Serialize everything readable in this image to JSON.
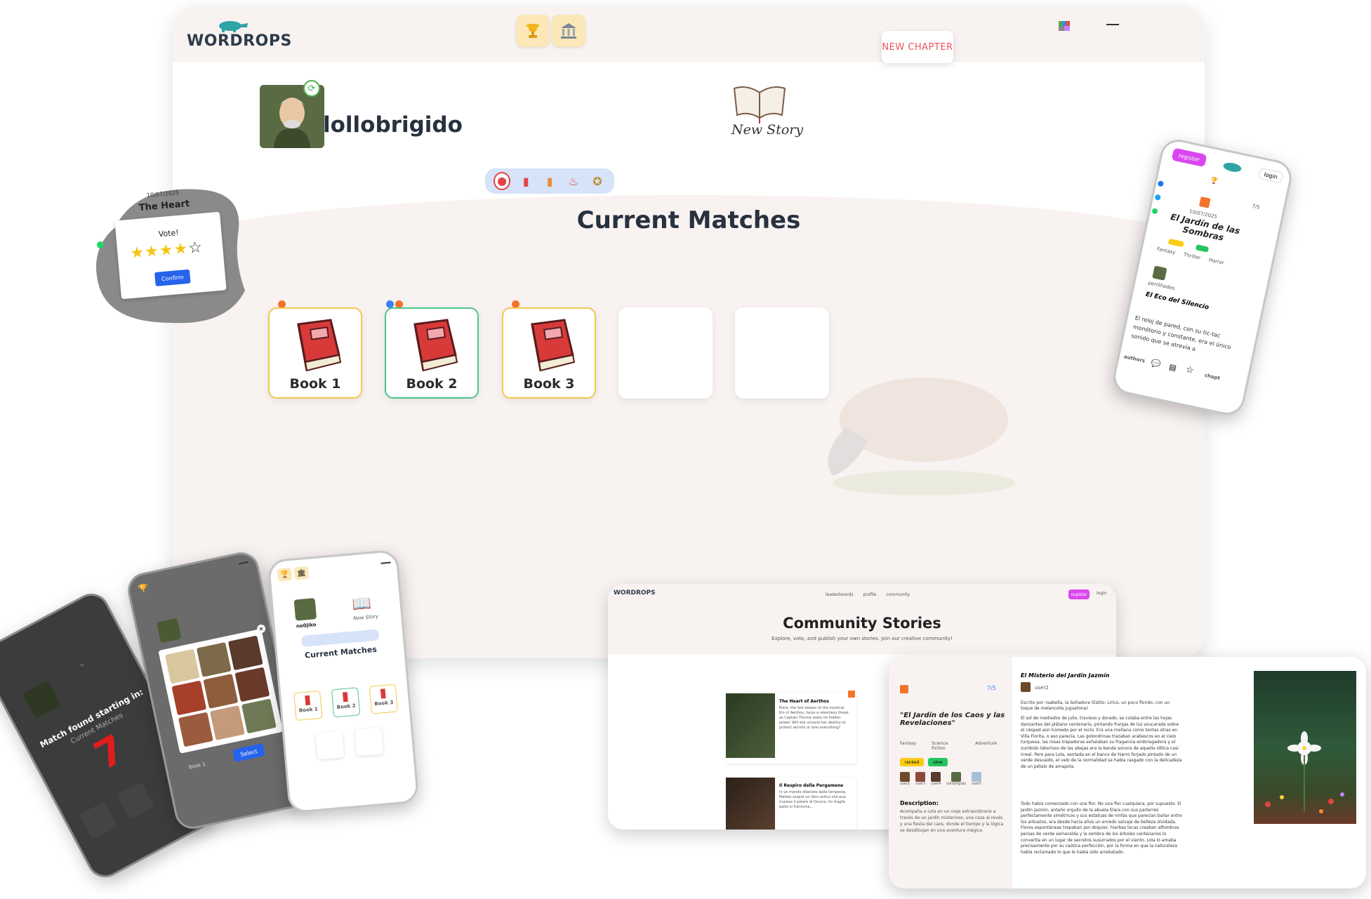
{
  "app": {
    "logo": "WORDROPS",
    "logo_icon": "platypus-icon"
  },
  "header": {
    "trophy_icon": "trophy-icon",
    "library_icon": "library-icon",
    "new_chapter_label": "NEW CHAPTER"
  },
  "profile": {
    "username": "lollobrigido",
    "new_story_label": "New Story"
  },
  "main": {
    "section_title": "Current Matches",
    "tabs": [
      "wax-seal-icon",
      "books-icon",
      "book-icon",
      "flame-icon",
      "medal-icon"
    ],
    "books": [
      {
        "label": "Book 1"
      },
      {
        "label": "Book 2"
      },
      {
        "label": "Book 3"
      }
    ]
  },
  "vote_popup": {
    "date": "10/07/2025",
    "title": "The Heart",
    "vote_label": "Vote!",
    "rating": 4,
    "max_rating": 5,
    "confirm_label": "Confirm"
  },
  "phone_right": {
    "register_label": "register",
    "login_label": "login",
    "date": "10/07/2025",
    "score": "7/5",
    "story_title": "El Jardín de las Sombras",
    "tags": [
      "Fantasy",
      "Thriller",
      "Horror"
    ],
    "author": "penShades",
    "second_title": "El Eco del Silencio",
    "excerpt": "El reloj de pared, con su tic-tac monótono y constante, era el único sonido que se atrevía a",
    "nav": [
      "authors",
      "chapt"
    ]
  },
  "phone_match": {
    "text": "Match found starting in:",
    "sub": "Current Matches",
    "countdown": "7"
  },
  "phone_select": {
    "select_label": "Select",
    "book_label": "Book 1"
  },
  "phone_current": {
    "username": "no0jiko",
    "new_story": "New Story",
    "title": "Current Matches",
    "books": [
      "Book 1",
      "Book 2",
      "Book 3"
    ]
  },
  "community": {
    "logo": "WORDROPS",
    "nav": [
      "leaderboards",
      "profile",
      "community"
    ],
    "register_label": "register",
    "login_label": "login",
    "title": "Community Stories",
    "subtitle": "Explore, vote, and publish your own stories. Join our creative community!",
    "stories": [
      {
        "title": "The Heart of Aerthos",
        "text": "Elara, the last keeper of the mystical Kin of Aerthos, faces a relentless threat as Captain Thorne seeks its hidden power. Will she unravel her destiny to protect secrets or lose everything?"
      },
      {
        "title": "Il Respiro della Pergamene",
        "text": "In un mondo dilaniato dalla tempesta, Matteo scopre un libro antico che può rivelare il potere di Oscura. Un fragile patto si frantuma..."
      }
    ]
  },
  "story_detail": {
    "score": "7/5",
    "quote_title": "\"El Jardín de los Caos y las Revelaciones\"",
    "tags": [
      "Fantasy",
      "Science Fiction",
      "Adventure"
    ],
    "badges": [
      "ranked",
      "slow"
    ],
    "users": [
      "user2",
      "user3",
      "user4",
      "lollobrigido",
      "user5"
    ],
    "description_label": "Description:",
    "description": "Acompaña a Lola en un viaje extraordinario a través de un jardín misterioso, una casa al revés y una fiesta del caos, donde el tiempo y la lógica se desdibujan en una aventura mágica.",
    "chapter_title": "El Misterio del Jardín Jazmín",
    "author": "user2",
    "written_by": "Escrito por: Isabella, la Soñadora (Estilo: Lírico, un poco florido, con un toque de melancolía juguetona)",
    "p1": "El sol de mediados de julio, travieso y dorado, se colaba entre las hojas danzantes del plátano centenario, pintando franjas de luz azucarada sobre el césped aún húmedo por el rocío. Era una mañana como tantas otras en Villa Fiorita, o eso parecía. Las golondrinas trazaban arabescos en el cielo turquesa, las rosas trepadoras exhalaban su fragancia embriagadora y el zumbido laborioso de las abejas era la banda sonora de aquella idílica casi irreal. Pero para Lola, sentada en el banco de hierro forjado pintado de un verde desvaído, el velo de la normalidad se había rasgado con la delicadeza de un pétalo de amapola.",
    "p2": "Todo había comenzado con una flor. No una flor cualquiera, por supuesto. El Jardín Jazmín, antaño orgullo de la abuela Elara con sus parterres perfectamente simétricos y sus estatuas de ninfas que parecían bailar entre los arbustos, era desde hacía años un enredo salvaje de belleza olvidada. Flores espontáneas trepaban por doquier, hierbas locas creaban alfombras persas de verde esmeralda y la sombra de los árboles centenarios lo convertía en un lugar de secretos susurrados por el viento. Lola lo amaba precisamente por su caótica perfección, por la forma en que la naturaleza había reclamado lo que le había sido arrebatado."
  }
}
